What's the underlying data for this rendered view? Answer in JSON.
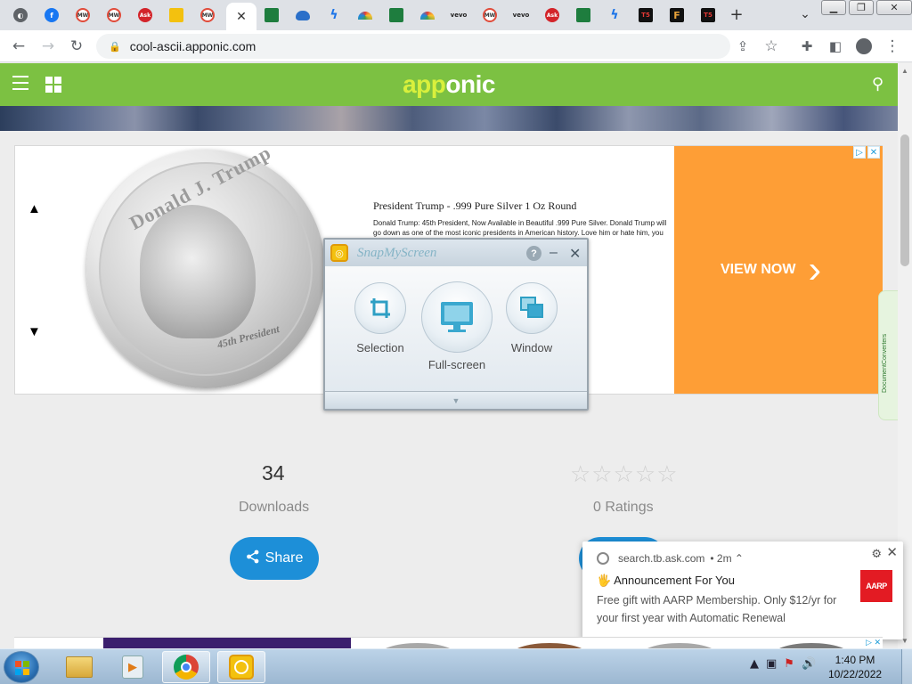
{
  "browser": {
    "tabs": [
      {
        "icon": "chrome-icon",
        "label": ""
      },
      {
        "icon": "facebook-icon",
        "label": "f"
      },
      {
        "icon": "mw-icon",
        "label": "MW"
      },
      {
        "icon": "mw-icon",
        "label": "MW"
      },
      {
        "icon": "ask-icon",
        "label": "Ask"
      },
      {
        "icon": "snapmyscreen-icon",
        "label": ""
      },
      {
        "icon": "mw-icon",
        "label": "MW"
      },
      {
        "icon": "close-icon",
        "label": "✕"
      },
      {
        "icon": "spreadsheet-icon",
        "label": ""
      },
      {
        "icon": "cloud-icon",
        "label": ""
      },
      {
        "icon": "lightning-icon",
        "label": "⚡"
      },
      {
        "icon": "rainbow-icon",
        "label": ""
      },
      {
        "icon": "spreadsheet-icon",
        "label": ""
      },
      {
        "icon": "rainbow-icon",
        "label": ""
      },
      {
        "icon": "vevo-icon",
        "label": "vevo"
      },
      {
        "icon": "mw-icon",
        "label": "MW"
      },
      {
        "icon": "vevo-icon",
        "label": "vevo"
      },
      {
        "icon": "ask-icon",
        "label": "Ask"
      },
      {
        "icon": "spreadsheet-icon",
        "label": ""
      },
      {
        "icon": "lightning-icon",
        "label": "⚡"
      },
      {
        "icon": "t5-icon",
        "label": "T5"
      },
      {
        "icon": "f-icon",
        "label": "F"
      },
      {
        "icon": "t5-icon",
        "label": "T5"
      }
    ],
    "new_tab_label": "+",
    "tab_search_label": "⌄",
    "window_buttons": {
      "minimize": "▁",
      "restore": "❐",
      "close": "✕"
    },
    "address": "cool-ascii.apponic.com"
  },
  "site": {
    "logo_part1": "app",
    "logo_part2": "onic"
  },
  "ad": {
    "coin_name": "Donald J. Trump",
    "coin_sub": "45th President",
    "title": "President Trump - .999 Pure Silver 1 Oz Round",
    "description": "Donald Trump: 45th President, Now Available in Beautiful .999 Pure Silver. Donald Trump will go down as one of the most iconic presidents in American history. Love him or hate him, you have to acknowledge the [...] in controversy. It [...] election. Millio...",
    "cta": "VIEW NOW",
    "adchoices": [
      "▷",
      "✕"
    ]
  },
  "snapmyscreen": {
    "title": "SnapMyScreen",
    "help": "?",
    "minimize": "–",
    "close": "✕",
    "options": [
      {
        "label": "Selection",
        "icon": "crop-icon"
      },
      {
        "label": "Full-screen",
        "icon": "monitor-icon"
      },
      {
        "label": "Window",
        "icon": "window-icon"
      }
    ],
    "expand": "▼"
  },
  "side_widget": {
    "label": "DocumentConverters"
  },
  "stats": {
    "downloads_count": "34",
    "downloads_label": "Downloads",
    "ratings_label": "0 Ratings",
    "star_count": 5,
    "stars": "☆☆☆☆☆"
  },
  "share_label": "Share",
  "notification": {
    "source": "search.tb.ask.com",
    "time": "• 2m ⌃",
    "title": "🖐 Announcement For You",
    "body": "Free gift with AARP Membership. Only $12/yr for your first year with Automatic Renewal",
    "badge": "AARP"
  },
  "taskbar": {
    "clock_time": "1:40 PM",
    "clock_date": "10/22/2022",
    "tray": [
      "▲",
      "▣",
      "⚑",
      "🔊"
    ]
  }
}
